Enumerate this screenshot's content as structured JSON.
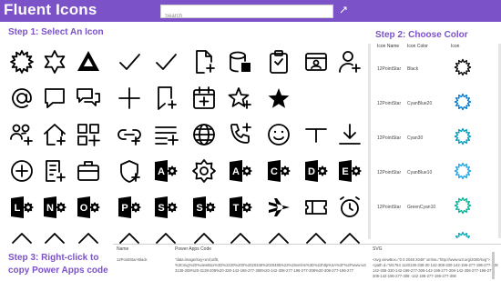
{
  "header": {
    "title": "Fluent Icons",
    "search_placeholder": "Search"
  },
  "steps": {
    "step1": "Step 1: Select An Icon",
    "step2": "Step 2: Choose Color",
    "step3_line1": "Step 3: Right-click to",
    "step3_line2": "copy Power Apps code"
  },
  "color_table": {
    "headers": [
      "Icon Name",
      "Icon Color",
      "Icon"
    ],
    "rows": [
      {
        "name": "12PointStar",
        "color": "Black",
        "hex": "#000000"
      },
      {
        "name": "12PointStar",
        "color": "CyanBlue20",
        "hex": "#0078d4"
      },
      {
        "name": "12PointStar",
        "color": "Cyan30",
        "hex": "#0099bc"
      },
      {
        "name": "12PointStar",
        "color": "CyanBlue10",
        "hex": "#1aa3e8"
      },
      {
        "name": "12PointStar",
        "color": "GreenCyan10",
        "hex": "#00b294"
      },
      {
        "name": "12PointStar",
        "color": "Cyan10",
        "hex": "#00a8b8"
      }
    ]
  },
  "icons": [
    [
      "star-12-icon",
      "star-6-icon",
      "azure-devops-icon",
      "checkmark-icon",
      "checkmark-icon",
      "doc-add-icon",
      "database-icon",
      "clipboard-icon",
      "contact-card-icon",
      "person-add-icon"
    ],
    [
      "at-icon",
      "chat-icon",
      "chat-multiple-icon",
      "add-icon",
      "bookmark-add-icon",
      "calendar-add-icon",
      "star-outline-add-icon",
      "star-filled-icon",
      "blank",
      "blank"
    ],
    [
      "people-add-icon",
      "home-add-icon",
      "grid-add-icon",
      "link-add-icon",
      "list-add-icon",
      "globe-add-icon",
      "phone-add-icon",
      "emoji-icon",
      "minus-bar-icon",
      "arrow-down-bar-icon"
    ],
    [
      "circle-add-icon",
      "list-box-add-icon",
      "briefcase-add-icon",
      "shield-add-icon",
      "access-icon",
      "settings-icon",
      "access-icon",
      "cortana-icon",
      "d-app-icon",
      "e-app-icon"
    ],
    [
      "lync-icon",
      "onenote-icon",
      "outlook-icon",
      "powerpoint-icon",
      "sway-icon",
      "sway-cog-icon",
      "teams-icon",
      "airplane-icon",
      "ticket-icon",
      "alarm-icon"
    ],
    [
      "row-partial",
      "row-partial",
      "row-partial",
      "row-partial",
      "row-partial",
      "row-partial",
      "row-partial",
      "row-partial",
      "row-partial",
      "row-partial"
    ]
  ],
  "glyph_letters": {
    "access-icon": "A",
    "d-app-icon": "D",
    "e-app-icon": "E",
    "lync-icon": "L",
    "onenote-icon": "N",
    "outlook-icon": "O",
    "powerpoint-icon": "P",
    "sway-icon": "S",
    "sway-cog-icon": "S",
    "teams-icon": "T",
    "cortana-icon": "C"
  },
  "bottom": {
    "headers": {
      "name": "Name",
      "code": "Power Apps Code",
      "svg": "SVG"
    },
    "name_value": "12PointStar-Black",
    "code_value": "\"data:image/svg+xml;utf8, %3Csvg%20%viewBox%3D%2220%200%2020346%2020485%22%20xmlns%3D%22http%3A%2F%2Fwww.w3.org%2F2000%2Fsvg%22%3E%3Cpath%20d%3D%22M1754%201120146%20-3138-208%20-3138-208%20-330-142-196-277-308%20-142-308-277-196-277-308%20-308-277-196-277",
    "svg_value": "<svg viewBox=\"0 0 2048 2048\" xmlns=\"http://www.w3.org/2000/svg\"><path d=\"M1754 1120146-338-30 142-308-330-142-196-277-196-277-308 142-308-330-142-196-277-308-142-196-277-308-142-308-277-196-277-308-142-196-277-308 -142 196-277-196-277-308"
  }
}
